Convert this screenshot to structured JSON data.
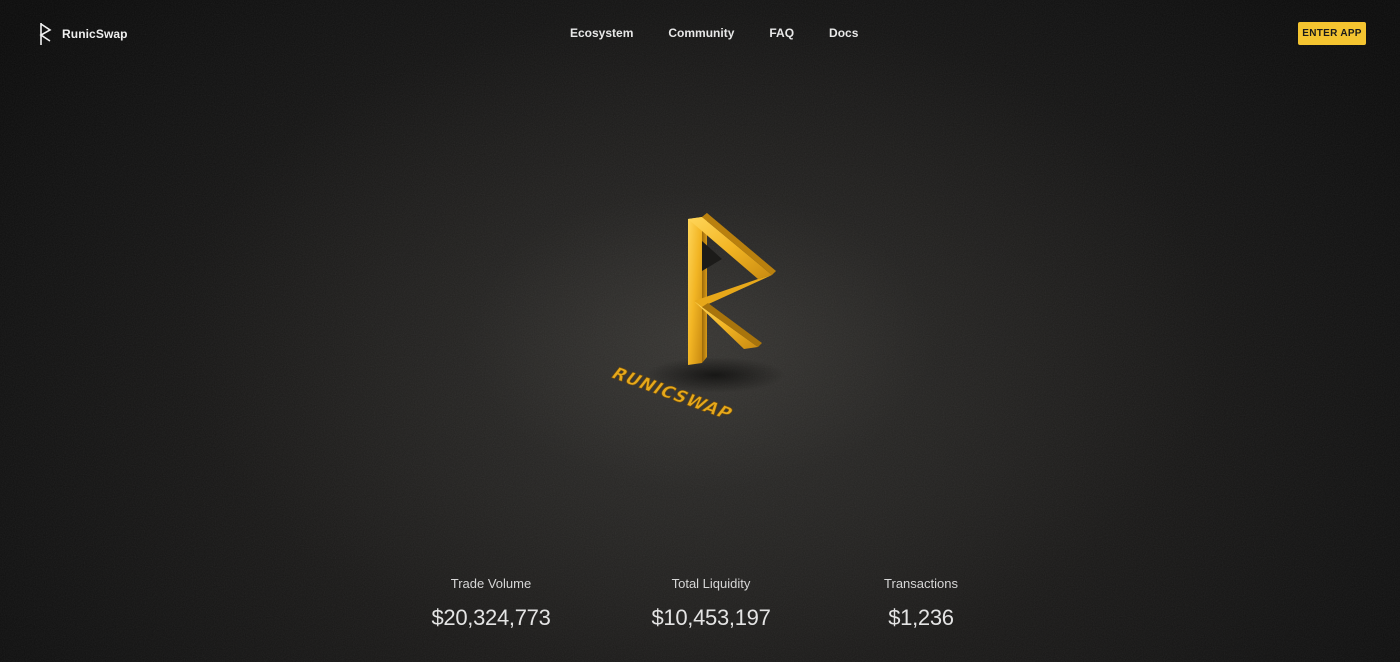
{
  "brand": {
    "name": "RunicSwap",
    "icon": "rune-logo-icon"
  },
  "nav": {
    "items": [
      {
        "label": "Ecosystem"
      },
      {
        "label": "Community"
      },
      {
        "label": "FAQ"
      },
      {
        "label": "Docs"
      }
    ]
  },
  "cta": {
    "label": "ENTER APP",
    "color": "#f4c430"
  },
  "hero": {
    "logo_text": "RUNICSWAP",
    "logo_icon": "golden-rune-3d-logo",
    "accent_color": "#e6a91c"
  },
  "stats": [
    {
      "label": "Trade Volume",
      "value": "$20,324,773"
    },
    {
      "label": "Total Liquidity",
      "value": "$10,453,197"
    },
    {
      "label": "Transactions",
      "value": "$1,236"
    }
  ]
}
